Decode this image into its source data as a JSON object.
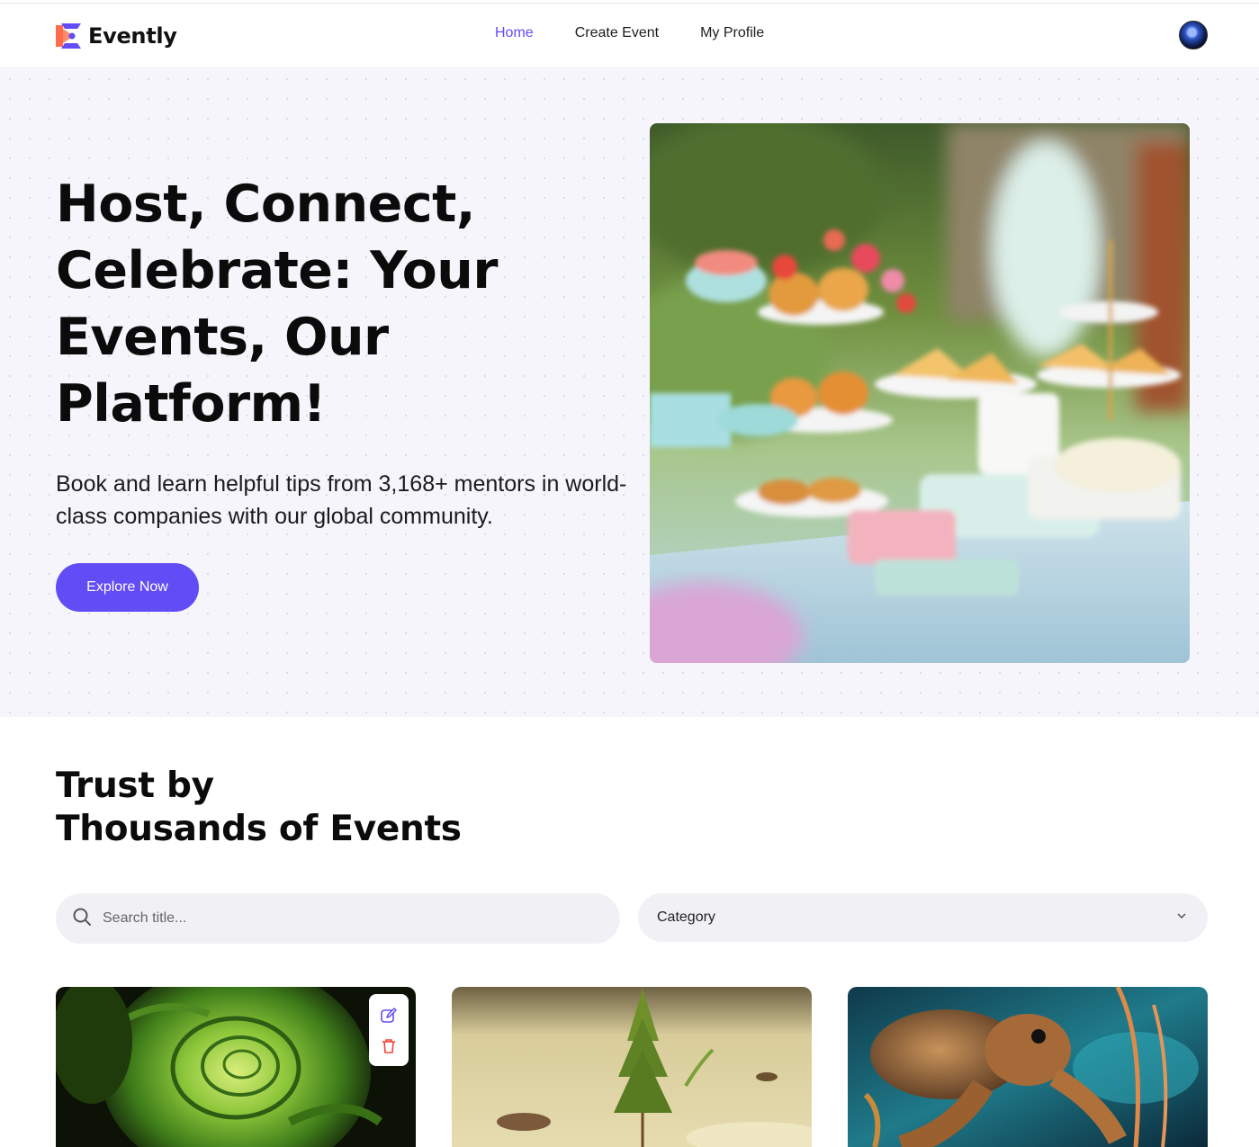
{
  "brand": {
    "name": "Evently"
  },
  "nav": {
    "items": [
      {
        "label": "Home",
        "active": true
      },
      {
        "label": "Create Event",
        "active": false
      },
      {
        "label": "My Profile",
        "active": false
      }
    ]
  },
  "hero": {
    "title": "Host, Connect, Celebrate: Your Events, Our Platform!",
    "subtitle": "Book and learn helpful tips from 3,168+ mentors in world-class companies with our global community.",
    "cta_label": "Explore Now"
  },
  "section": {
    "title_line1": "Trust by",
    "title_line2": "Thousands of Events"
  },
  "filters": {
    "search_placeholder": "Search title...",
    "category_label": "Category"
  },
  "colors": {
    "accent": "#624cf5",
    "delete": "#f04438"
  },
  "cards": [
    {
      "image": "green rose with water drops",
      "editable": true
    },
    {
      "image": "small pine sapling in sand",
      "editable": false
    },
    {
      "image": "sea turtle underwater",
      "editable": false
    }
  ]
}
